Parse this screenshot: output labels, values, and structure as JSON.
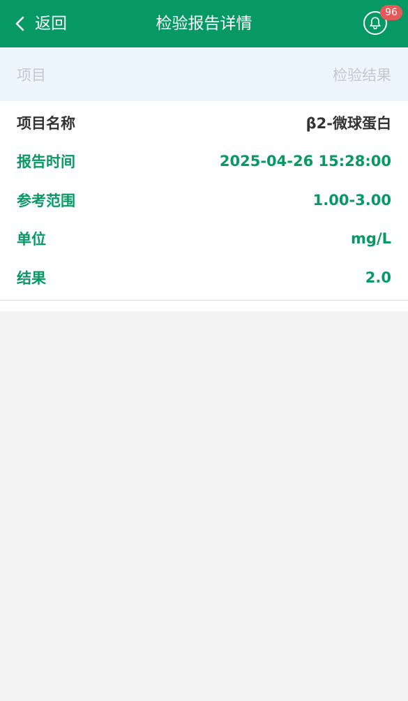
{
  "header": {
    "back_label": "返回",
    "title": "检验报告详情",
    "notification_count": "96",
    "bg_color": "#079965",
    "badge_color": "#e55a58"
  },
  "table_header": {
    "left": "项目",
    "right": "检验结果"
  },
  "rows": [
    {
      "label": "项目名称",
      "value": "β2-微球蛋白"
    },
    {
      "label": "报告时间",
      "value": "2025-04-26 15:28:00"
    },
    {
      "label": "参考范围",
      "value": "1.00-3.00"
    },
    {
      "label": "单位",
      "value": "mg/L"
    },
    {
      "label": "结果",
      "value": "2.0"
    }
  ]
}
